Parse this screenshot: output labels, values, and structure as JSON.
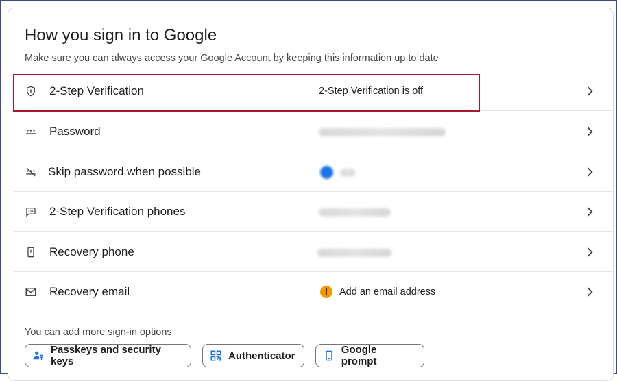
{
  "section": {
    "title": "How you sign in to Google",
    "subtitle": "Make sure you can always access your Google Account by keeping this information up to date"
  },
  "rows": [
    {
      "label": "2-Step Verification",
      "value": "2-Step Verification is off",
      "icon": "shield-icon"
    },
    {
      "label": "Password",
      "value": "",
      "icon": "password-dots-icon"
    },
    {
      "label": "Skip password when possible",
      "value": "",
      "icon": "passkey-skip-icon"
    },
    {
      "label": "2-Step Verification phones",
      "value": "",
      "icon": "message-icon"
    },
    {
      "label": "Recovery phone",
      "value": "",
      "icon": "phone-icon"
    },
    {
      "label": "Recovery email",
      "value": "Add an email address",
      "icon": "mail-icon"
    }
  ],
  "more_options": {
    "text": "You can add more sign-in options",
    "chips": [
      {
        "label": "Passkeys and security keys",
        "icon": "person-key-icon"
      },
      {
        "label": "Authenticator",
        "icon": "qr-code-icon"
      },
      {
        "label": "Google prompt",
        "icon": "smartphone-icon"
      }
    ]
  },
  "colors": {
    "highlight": "#a5172d",
    "toggle_on": "#1a73e8",
    "warning": "#f29900",
    "chip_icon": "#1a73e8"
  }
}
